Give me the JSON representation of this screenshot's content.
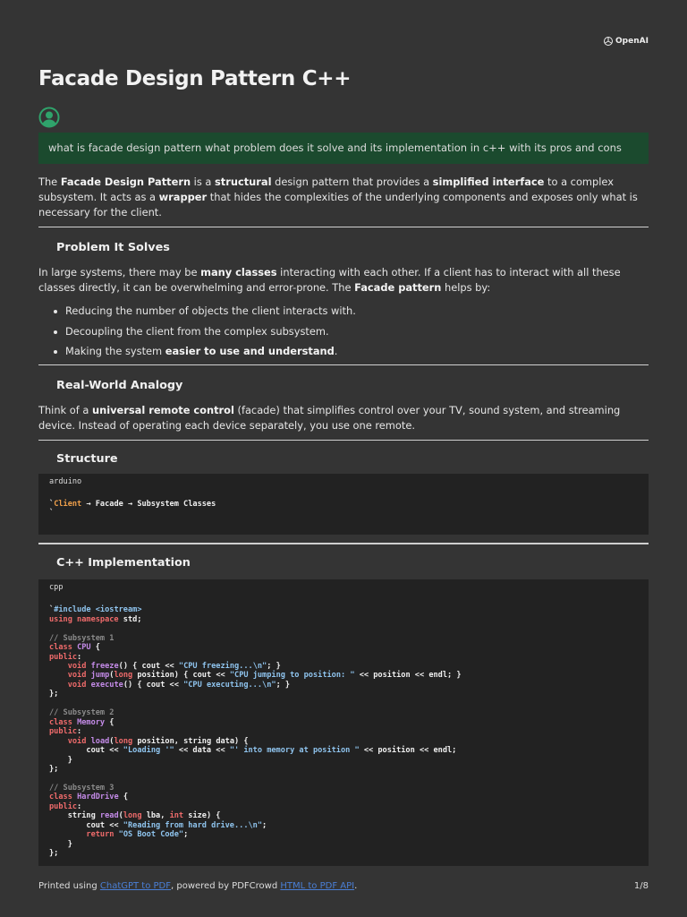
{
  "brand": {
    "logo_text": "OpenAI"
  },
  "title": "Facade Design Pattern C++",
  "prompt": "what is facade design pattern what problem does it solve and its implementation in c++ with its pros and cons",
  "intro": [
    {
      "t": "The "
    },
    {
      "t": "Facade Design Pattern",
      "b": true
    },
    {
      "t": " is a "
    },
    {
      "t": "structural",
      "b": true
    },
    {
      "t": " design pattern that provides a "
    },
    {
      "t": "simplified interface",
      "b": true
    },
    {
      "t": " to a complex subsystem. It acts as a "
    },
    {
      "t": "wrapper",
      "b": true
    },
    {
      "t": " that hides the complexities of the underlying components and exposes only what is necessary for the client."
    }
  ],
  "problem": {
    "heading": "Problem It Solves",
    "text": [
      {
        "t": "In large systems, there may be "
      },
      {
        "t": "many classes",
        "b": true
      },
      {
        "t": " interacting with each other. If a client has to interact with all these classes directly, it can be overwhelming and error-prone. The "
      },
      {
        "t": "Facade pattern",
        "b": true
      },
      {
        "t": " helps by:"
      }
    ],
    "bullets": [
      [
        {
          "t": "Reducing the number of objects the client interacts with."
        }
      ],
      [
        {
          "t": "Decoupling the client from the complex subsystem."
        }
      ],
      [
        {
          "t": "Making the system "
        },
        {
          "t": "easier to use and understand",
          "b": true
        },
        {
          "t": "."
        }
      ]
    ]
  },
  "analogy": {
    "heading": "Real-World Analogy",
    "text": [
      {
        "t": "Think of a "
      },
      {
        "t": "universal remote control",
        "b": true
      },
      {
        "t": " (facade) that simplifies control over your TV, sound system, and streaming device. Instead of operating each device separately, you use one remote."
      }
    ]
  },
  "structure": {
    "heading": "Structure",
    "code": {
      "lang": "arduino",
      "lines": [
        [
          [
            "p",
            "`"
          ],
          [
            "o",
            "Client"
          ],
          [
            "p",
            " → Facade → Subsystem Classes"
          ]
        ],
        [
          [
            "p",
            "`"
          ]
        ]
      ]
    }
  },
  "implementation": {
    "heading": "C++ Implementation",
    "code": {
      "lang": "cpp",
      "lines": [
        [
          [
            "p",
            "`"
          ],
          [
            "s",
            "#include <iostream>"
          ]
        ],
        [
          [
            "k",
            "using namespace"
          ],
          [
            "p",
            " std;"
          ]
        ],
        [],
        [
          [
            "c",
            "// Subsystem 1"
          ]
        ],
        [
          [
            "k",
            "class"
          ],
          [
            "p",
            " "
          ],
          [
            "t",
            "CPU"
          ],
          [
            "p",
            " {"
          ]
        ],
        [
          [
            "k",
            "public"
          ],
          [
            "p",
            ":"
          ]
        ],
        [
          [
            "p",
            "    "
          ],
          [
            "k",
            "void"
          ],
          [
            "p",
            " "
          ],
          [
            "t",
            "freeze"
          ],
          [
            "p",
            "() { cout << "
          ],
          [
            "s",
            "\"CPU freezing...\\n\""
          ],
          [
            "p",
            "; }"
          ]
        ],
        [
          [
            "p",
            "    "
          ],
          [
            "k",
            "void"
          ],
          [
            "p",
            " "
          ],
          [
            "t",
            "jump"
          ],
          [
            "p",
            "("
          ],
          [
            "k",
            "long"
          ],
          [
            "p",
            " position) { cout << "
          ],
          [
            "s",
            "\"CPU jumping to position: \""
          ],
          [
            "p",
            " << position << endl; }"
          ]
        ],
        [
          [
            "p",
            "    "
          ],
          [
            "k",
            "void"
          ],
          [
            "p",
            " "
          ],
          [
            "t",
            "execute"
          ],
          [
            "p",
            "() { cout << "
          ],
          [
            "s",
            "\"CPU executing...\\n\""
          ],
          [
            "p",
            "; }"
          ]
        ],
        [
          [
            "p",
            "};"
          ]
        ],
        [],
        [
          [
            "c",
            "// Subsystem 2"
          ]
        ],
        [
          [
            "k",
            "class"
          ],
          [
            "p",
            " "
          ],
          [
            "t",
            "Memory"
          ],
          [
            "p",
            " {"
          ]
        ],
        [
          [
            "k",
            "public"
          ],
          [
            "p",
            ":"
          ]
        ],
        [
          [
            "p",
            "    "
          ],
          [
            "k",
            "void"
          ],
          [
            "p",
            " "
          ],
          [
            "t",
            "load"
          ],
          [
            "p",
            "("
          ],
          [
            "k",
            "long"
          ],
          [
            "p",
            " position, string data) {"
          ]
        ],
        [
          [
            "p",
            "        cout << "
          ],
          [
            "s",
            "\"Loading '\""
          ],
          [
            "p",
            " << data << "
          ],
          [
            "s",
            "\"' into memory at position \""
          ],
          [
            "p",
            " << position << endl;"
          ]
        ],
        [
          [
            "p",
            "    }"
          ]
        ],
        [
          [
            "p",
            "};"
          ]
        ],
        [],
        [
          [
            "c",
            "// Subsystem 3"
          ]
        ],
        [
          [
            "k",
            "class"
          ],
          [
            "p",
            " "
          ],
          [
            "t",
            "HardDrive"
          ],
          [
            "p",
            " {"
          ]
        ],
        [
          [
            "k",
            "public"
          ],
          [
            "p",
            ":"
          ]
        ],
        [
          [
            "p",
            "    string "
          ],
          [
            "t",
            "read"
          ],
          [
            "p",
            "("
          ],
          [
            "k",
            "long"
          ],
          [
            "p",
            " lba, "
          ],
          [
            "k",
            "int"
          ],
          [
            "p",
            " size) {"
          ]
        ],
        [
          [
            "p",
            "        cout << "
          ],
          [
            "s",
            "\"Reading from hard drive...\\n\""
          ],
          [
            "p",
            ";"
          ]
        ],
        [
          [
            "p",
            "        "
          ],
          [
            "k",
            "return"
          ],
          [
            "p",
            " "
          ],
          [
            "s",
            "\"OS Boot Code\""
          ],
          [
            "p",
            ";"
          ]
        ],
        [
          [
            "p",
            "    }"
          ]
        ],
        [
          [
            "p",
            "};"
          ]
        ]
      ]
    }
  },
  "footer": {
    "prefix": "Printed using ",
    "link1": "ChatGPT to PDF",
    "middle": ", powered by PDFCrowd ",
    "link2": "HTML to PDF API",
    "suffix": ".",
    "page": "1/8"
  },
  "colors": {
    "prompt_bg": "#1b4a2e",
    "avatar": "#2fa36b",
    "link": "#4a7fd6",
    "code_bg": "#222222"
  }
}
